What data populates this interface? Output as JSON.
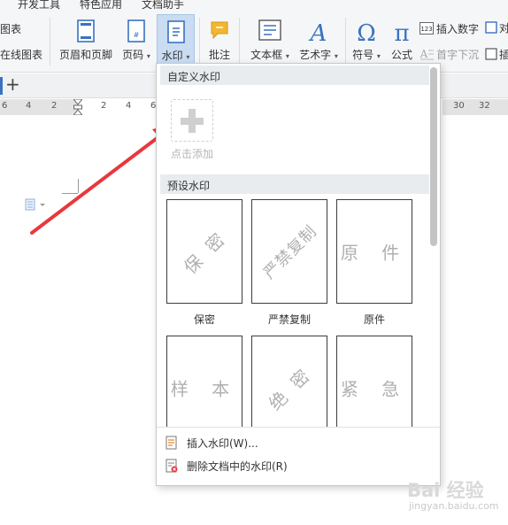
{
  "menu_tabs": [
    "开发工具",
    "特色应用",
    "文档助手"
  ],
  "ribbon": {
    "left_items": [
      "图表",
      "在线图表"
    ],
    "header_footer_label": "页眉和页脚",
    "page_number_label": "页码",
    "watermark_label": "水印",
    "comment_label": "批注",
    "textbox_label": "文本框",
    "art_text_label": "艺术字",
    "symbol_label": "符号",
    "formula_label": "公式",
    "insert_number_label": "插入数字",
    "drop_cap_label": "首字下沉",
    "object_label_partial": "对",
    "attach_label_partial": "插"
  },
  "ruler_ticks": [
    "6",
    "4",
    "2",
    "2",
    "4",
    "6",
    "30",
    "32"
  ],
  "dropdown": {
    "custom_section": "自定义水印",
    "add_label": "点击添加",
    "preset_section": "预设水印",
    "presets": [
      {
        "label": "保密",
        "watermark": "保 密",
        "style": "diag"
      },
      {
        "label": "严禁复制",
        "watermark": "严禁复制",
        "style": "diag"
      },
      {
        "label": "原件",
        "watermark": "原 件",
        "style": "flat"
      },
      {
        "label": "样本",
        "watermark": "样 本",
        "style": "flat"
      },
      {
        "label": "绝密",
        "watermark": "绝 密",
        "style": "diag"
      },
      {
        "label": "紧急",
        "watermark": "紧 急",
        "style": "flat"
      }
    ],
    "insert_item": "插入水印(W)...",
    "delete_item": "删除文档中的水印(R)"
  },
  "baidu": {
    "brand": "Bai 经验",
    "url": "jingyan.baidu.com"
  },
  "colors": {
    "ribbon_bg": "#f5f6f7",
    "active_button_bg": "#c9dcf2",
    "arrow": "#e8383d",
    "icon_blue": "#3a72c0"
  }
}
